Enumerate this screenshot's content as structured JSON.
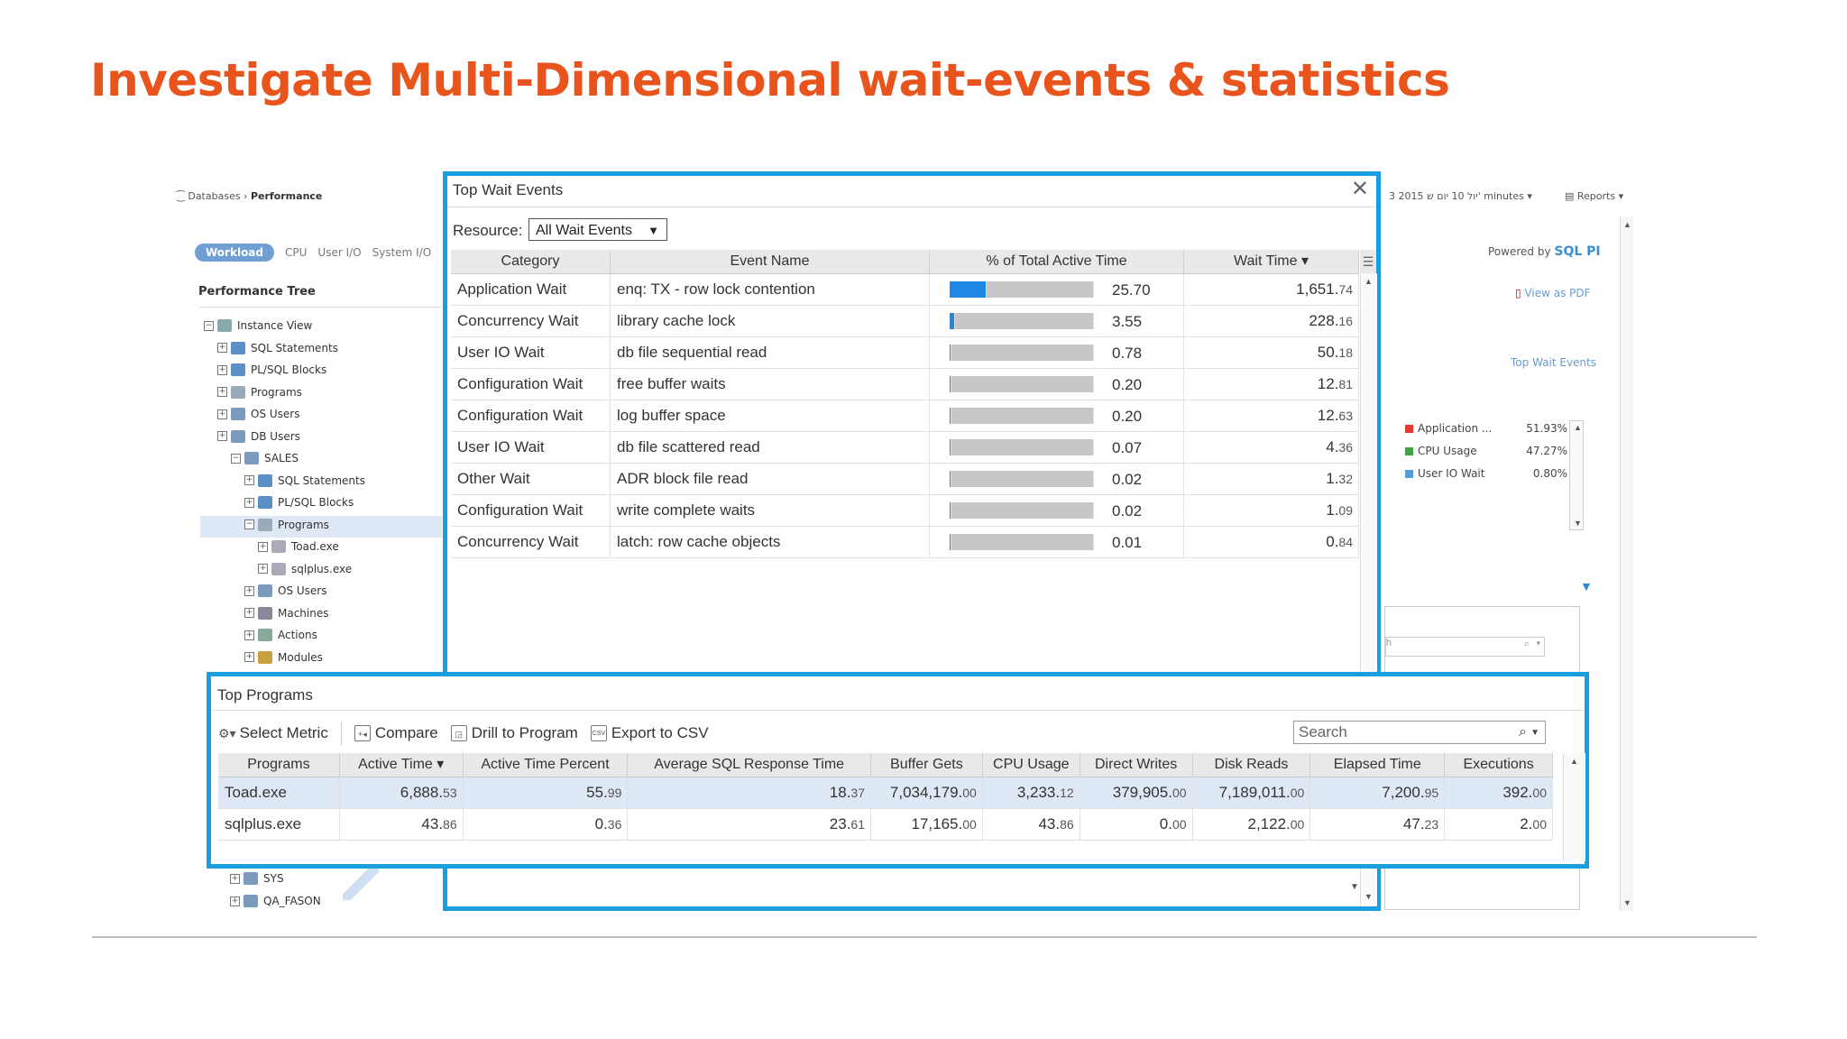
{
  "slide": {
    "title": "Investigate Multi-Dimensional wait-events & statistics"
  },
  "app": {
    "breadcrumb": {
      "root": "Databases",
      "current": "Performance"
    },
    "tabs": [
      "Workload",
      "CPU",
      "User I/O",
      "System I/O"
    ],
    "top_right": {
      "date_range": "3 2015 יול 10 יום ש' minutes",
      "reports": "Reports"
    },
    "powered_by": {
      "label": "Powered by",
      "brand": "SQL PI"
    },
    "view_as_pdf": "View as PDF",
    "top_wait_events_link": "Top Wait Events",
    "legend": [
      {
        "name": "Application ...",
        "pct": "51.93%",
        "color": "#e53935"
      },
      {
        "name": "CPU Usage",
        "pct": "47.27%",
        "color": "#43a047"
      },
      {
        "name": "User IO Wait",
        "pct": "0.80%",
        "color": "#5b9bd5"
      }
    ],
    "mini_search_placeholder": "h",
    "performance_tree": {
      "title": "Performance Tree",
      "items": [
        {
          "label": "Instance View",
          "level": 0,
          "icon": "instance-icon"
        },
        {
          "label": "SQL Statements",
          "level": 1,
          "icon": "sql-icon"
        },
        {
          "label": "PL/SQL Blocks",
          "level": 1,
          "icon": "plsql-icon"
        },
        {
          "label": "Programs",
          "level": 1,
          "icon": "programs-icon"
        },
        {
          "label": "OS Users",
          "level": 1,
          "icon": "os-users-icon"
        },
        {
          "label": "DB Users",
          "level": 1,
          "icon": "db-users-icon"
        },
        {
          "label": "SALES",
          "level": 2,
          "icon": "db-user-icon"
        },
        {
          "label": "SQL Statements",
          "level": 3,
          "icon": "sql-icon"
        },
        {
          "label": "PL/SQL Blocks",
          "level": 3,
          "icon": "plsql-icon"
        },
        {
          "label": "Programs",
          "level": 3,
          "icon": "programs-icon",
          "selected": true
        },
        {
          "label": "Toad.exe",
          "level": 4,
          "icon": "program-icon"
        },
        {
          "label": "sqlplus.exe",
          "level": 4,
          "icon": "program-icon"
        },
        {
          "label": "OS Users",
          "level": 3,
          "icon": "os-users-icon"
        },
        {
          "label": "Machines",
          "level": 3,
          "icon": "machines-icon"
        },
        {
          "label": "Actions",
          "level": 3,
          "icon": "actions-icon"
        },
        {
          "label": "Modules",
          "level": 3,
          "icon": "modules-icon"
        }
      ],
      "bottom_items": [
        {
          "label": "SYS",
          "icon": "db-user-icon"
        },
        {
          "label": "QA_FASON",
          "icon": "db-user-icon"
        }
      ]
    }
  },
  "top_wait_events": {
    "title": "Top Wait Events",
    "close_label": "✕",
    "resource_label": "Resource:",
    "resource_value": "All Wait Events",
    "columns": [
      "Category",
      "Event Name",
      "% of Total Active Time",
      "Wait Time ▾"
    ],
    "rows": [
      {
        "category": "Application Wait",
        "event": "enq: TX - row lock contention",
        "pct": 25.7,
        "pct_text": "25.70",
        "wait_int": "1,651.",
        "wait_dec": "74"
      },
      {
        "category": "Concurrency Wait",
        "event": "library cache lock",
        "pct": 3.55,
        "pct_text": "3.55",
        "wait_int": "228.",
        "wait_dec": "16"
      },
      {
        "category": "User IO Wait",
        "event": "db file sequential read",
        "pct": 0.78,
        "pct_text": "0.78",
        "wait_int": "50.",
        "wait_dec": "18"
      },
      {
        "category": "Configuration Wait",
        "event": "free buffer waits",
        "pct": 0.2,
        "pct_text": "0.20",
        "wait_int": "12.",
        "wait_dec": "81"
      },
      {
        "category": "Configuration Wait",
        "event": "log buffer space",
        "pct": 0.2,
        "pct_text": "0.20",
        "wait_int": "12.",
        "wait_dec": "63"
      },
      {
        "category": "User IO Wait",
        "event": "db file scattered read",
        "pct": 0.07,
        "pct_text": "0.07",
        "wait_int": "4.",
        "wait_dec": "36"
      },
      {
        "category": "Other Wait",
        "event": "ADR block file read",
        "pct": 0.02,
        "pct_text": "0.02",
        "wait_int": "1.",
        "wait_dec": "32"
      },
      {
        "category": "Configuration Wait",
        "event": "write complete waits",
        "pct": 0.02,
        "pct_text": "0.02",
        "wait_int": "1.",
        "wait_dec": "09"
      },
      {
        "category": "Concurrency Wait",
        "event": "latch: row cache objects",
        "pct": 0.01,
        "pct_text": "0.01",
        "wait_int": "0.",
        "wait_dec": "84"
      }
    ],
    "bar_max_pct": 100
  },
  "top_programs": {
    "title": "Top Programs",
    "toolbar": {
      "select_metric": "Select Metric",
      "compare": "Compare",
      "drill": "Drill to Program",
      "export": "Export to CSV",
      "search_placeholder": "Search"
    },
    "columns": [
      "Programs",
      "Active Time ▾",
      "Active Time Percent",
      "Average SQL Response Time",
      "Buffer Gets",
      "CPU Usage",
      "Direct Writes",
      "Disk Reads",
      "Elapsed Time",
      "Executions"
    ],
    "rows": [
      {
        "program": "Toad.exe",
        "cells": [
          [
            "6,888.",
            "53"
          ],
          [
            "55.",
            "99"
          ],
          [
            "18.",
            "37"
          ],
          [
            "7,034,179.",
            "00"
          ],
          [
            "3,233.",
            "12"
          ],
          [
            "379,905.",
            "00"
          ],
          [
            "7,189,011.",
            "00"
          ],
          [
            "7,200.",
            "95"
          ],
          [
            "392.",
            "00"
          ]
        ]
      },
      {
        "program": "sqlplus.exe",
        "cells": [
          [
            "43.",
            "86"
          ],
          [
            "0.",
            "36"
          ],
          [
            "23.",
            "61"
          ],
          [
            "17,165.",
            "00"
          ],
          [
            "43.",
            "86"
          ],
          [
            "0.",
            "00"
          ],
          [
            "2,122.",
            "00"
          ],
          [
            "47.",
            "23"
          ],
          [
            "2.",
            "00"
          ]
        ]
      }
    ]
  }
}
